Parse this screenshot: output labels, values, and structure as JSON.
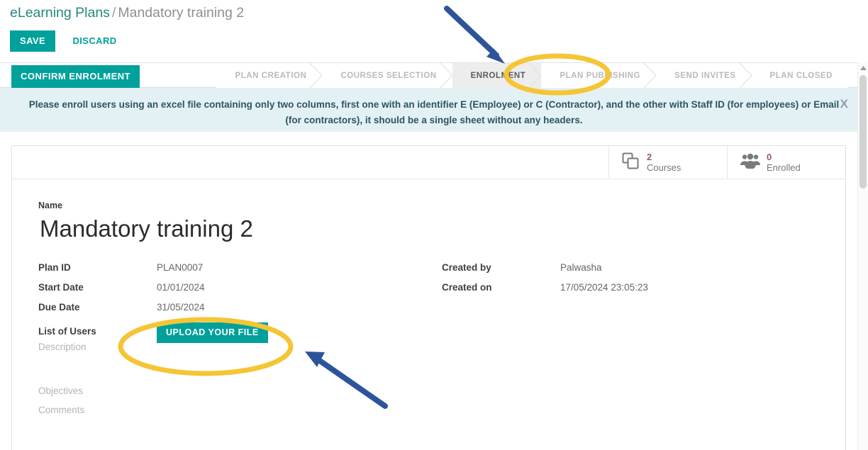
{
  "breadcrumb": {
    "parent": "eLearning Plans",
    "separator": "/",
    "current": "Mandatory training 2"
  },
  "toolbar": {
    "save_label": "SAVE",
    "discard_label": "DISCARD"
  },
  "statusbar": {
    "confirm_label": "CONFIRM ENROLMENT",
    "steps": [
      {
        "label": "PLAN CREATION",
        "active": false
      },
      {
        "label": "COURSES SELECTION",
        "active": false
      },
      {
        "label": "ENROLMENT",
        "active": true
      },
      {
        "label": "PLAN PUBLISHING",
        "active": false
      },
      {
        "label": "SEND INVITES",
        "active": false
      },
      {
        "label": "PLAN CLOSED",
        "active": false
      }
    ]
  },
  "alert": {
    "line1": "Please enroll users using an excel file containing only two columns, first one with an identifier E (Employee) or C (Contractor), and the other with Staff ID (for employees) or Email",
    "line2": "(for contractors), it should be a single sheet without any headers.",
    "close_label": "X"
  },
  "stats": [
    {
      "value": "2",
      "label": "Courses",
      "icon": "documents-icon"
    },
    {
      "value": "0",
      "label": "Enrolled",
      "icon": "users-icon"
    }
  ],
  "record": {
    "name_label": "Name",
    "name_value": "Mandatory training 2",
    "left_fields": [
      {
        "label": "Plan ID",
        "value": "PLAN0007"
      },
      {
        "label": "Start Date",
        "value": "01/01/2024"
      },
      {
        "label": "Due Date",
        "value": "31/05/2024"
      }
    ],
    "list_of_users_label": "List of Users",
    "upload_label": "UPLOAD YOUR FILE",
    "description_label": "Description",
    "objectives_label": "Objectives",
    "comments_label": "Comments",
    "right_fields": [
      {
        "label": "Created by",
        "value": "Palwasha"
      },
      {
        "label": "Created on",
        "value": "17/05/2024 23:05:23"
      }
    ]
  },
  "theme": {
    "accent_teal": "#00a19b",
    "link_teal": "#22897e",
    "banner_bg": "#e4f1f4",
    "banner_text": "#2c5560",
    "stat_value": "#9b5774",
    "annotation_yellow": "#f5c536",
    "annotation_blue": "#2d549b"
  }
}
